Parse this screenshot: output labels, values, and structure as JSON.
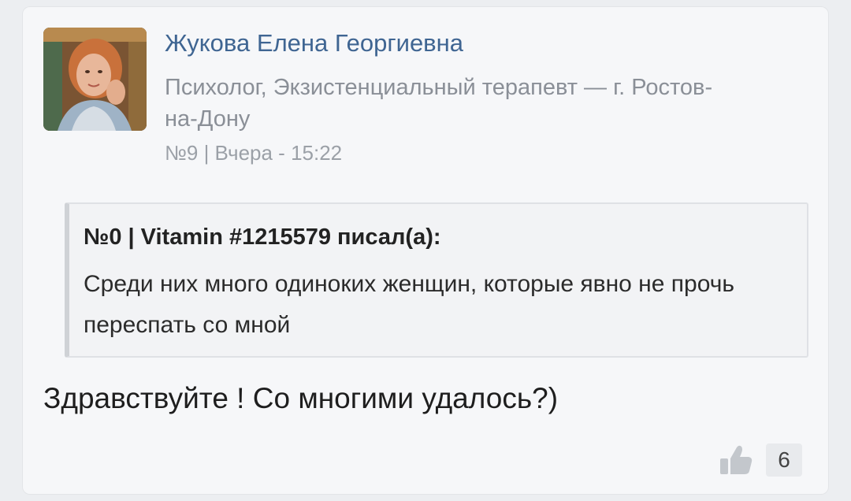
{
  "post": {
    "author": {
      "name": "Жукова Елена Георгиевна",
      "description": "Психолог, Экзистенциальный терапевт — г. Ростов-на-Дону"
    },
    "meta": "№9 | Вчера - 15:22",
    "quote": {
      "header": "№0 | Vitamin #1215579 писал(а):",
      "text": "Среди них много одиноких женщин, которые явно не прочь переспать со мной"
    },
    "reply": "Здравствуйте ! Со многими удалось?)",
    "likes": {
      "icon": "thumbs-up-icon",
      "count": "6"
    }
  }
}
